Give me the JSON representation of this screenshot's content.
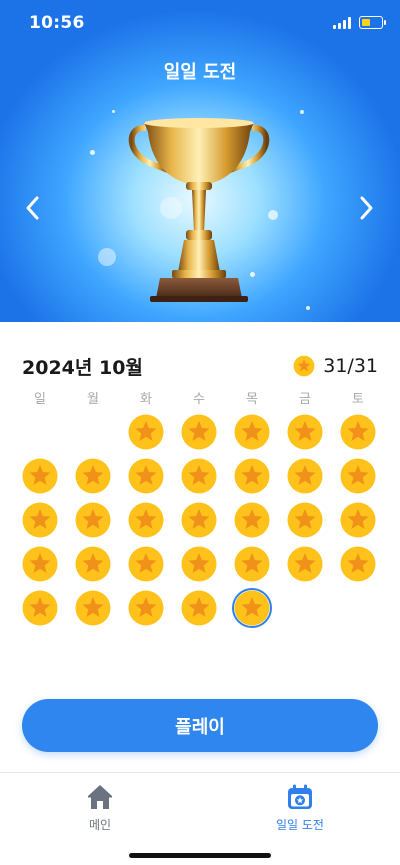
{
  "status_bar": {
    "time": "10:56"
  },
  "header": {
    "title": "일일 도전",
    "prev_icon": "chevron-left-icon",
    "next_icon": "chevron-right-icon",
    "hero_image": "trophy"
  },
  "calendar": {
    "month": "2024년 10월",
    "completed_count": "31/31",
    "weekdays": [
      "일",
      "월",
      "화",
      "수",
      "목",
      "금",
      "토"
    ],
    "first_weekday_index": 2,
    "days_in_month": 31,
    "completed_days": [
      1,
      2,
      3,
      4,
      5,
      6,
      7,
      8,
      9,
      10,
      11,
      12,
      13,
      14,
      15,
      16,
      17,
      18,
      19,
      20,
      21,
      22,
      23,
      24,
      25,
      26,
      27,
      28,
      29,
      30,
      31
    ],
    "today": 31
  },
  "play_button": {
    "label": "플레이"
  },
  "tabs": [
    {
      "label": "메인",
      "icon": "home-icon",
      "active": false
    },
    {
      "label": "일일 도전",
      "icon": "calendar-star-icon",
      "active": true
    }
  ],
  "colors": {
    "accent": "#2F86EE",
    "star_coin": "#FFC21A",
    "star": "#F0911A",
    "weekday_text": "#A8A8A8"
  }
}
